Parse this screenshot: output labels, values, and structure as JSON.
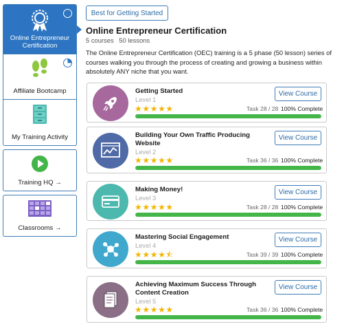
{
  "sidebar": {
    "items": [
      {
        "label": "Online Entrepreneur Certification",
        "icon": "award-ribbon-icon",
        "active": true
      },
      {
        "label": "Affiliate Bootcamp",
        "icon": "footprints-icon",
        "active": false
      },
      {
        "label": "My Training Activity",
        "icon": "file-cabinet-icon",
        "active": false
      }
    ],
    "links": [
      {
        "label": "Training HQ →",
        "icon": "play-icon"
      },
      {
        "label": "Classrooms →",
        "icon": "grid-icon"
      }
    ]
  },
  "header": {
    "best_button": "Best for Getting Started",
    "title": "Online Entrepreneur Certification",
    "courses": "5 courses",
    "lessons": "50 lessons",
    "description": "The Online Entrepreneur Certification (OEC) training is a 5 phase (50 lesson) series of courses walking you through the process of creating and growing a business within absolutely ANY niche that you want."
  },
  "courses": [
    {
      "title": "Getting Started",
      "level": "Level 1",
      "task": "Task 28 / 28",
      "complete": "100% Complete",
      "progress": 1.0,
      "rating": 5,
      "button": "View Course",
      "icon": "rocket-icon",
      "color": "#a6689d"
    },
    {
      "title": "Building Your Own Traffic Producing Website",
      "level": "Level 2",
      "task": "Task 36 / 36",
      "complete": "100% Complete",
      "progress": 1.0,
      "rating": 5,
      "button": "View Course",
      "icon": "chart-monitor-icon",
      "color": "#4f6aa6"
    },
    {
      "title": "Making Money!",
      "level": "Level 3",
      "task": "Task 28 / 28",
      "complete": "100% Complete",
      "progress": 1.0,
      "rating": 5,
      "button": "View Course",
      "icon": "credit-card-icon",
      "color": "#4cb8ae"
    },
    {
      "title": "Mastering Social Engagement",
      "level": "Level 4",
      "task": "Task 39 / 39",
      "complete": "100% Complete",
      "progress": 1.0,
      "rating": 4.5,
      "button": "View Course",
      "icon": "social-network-icon",
      "color": "#3fa8cc"
    },
    {
      "title": "Achieving Maximum Success Through Content Creation",
      "level": "Level 5",
      "task": "Task 36 / 36",
      "complete": "100% Complete",
      "progress": 1.0,
      "rating": 5,
      "button": "View Course",
      "icon": "documents-icon",
      "color": "#8a6f86"
    }
  ],
  "stars": {
    "full": "★★★★★",
    "half": "★★★★⯪"
  }
}
